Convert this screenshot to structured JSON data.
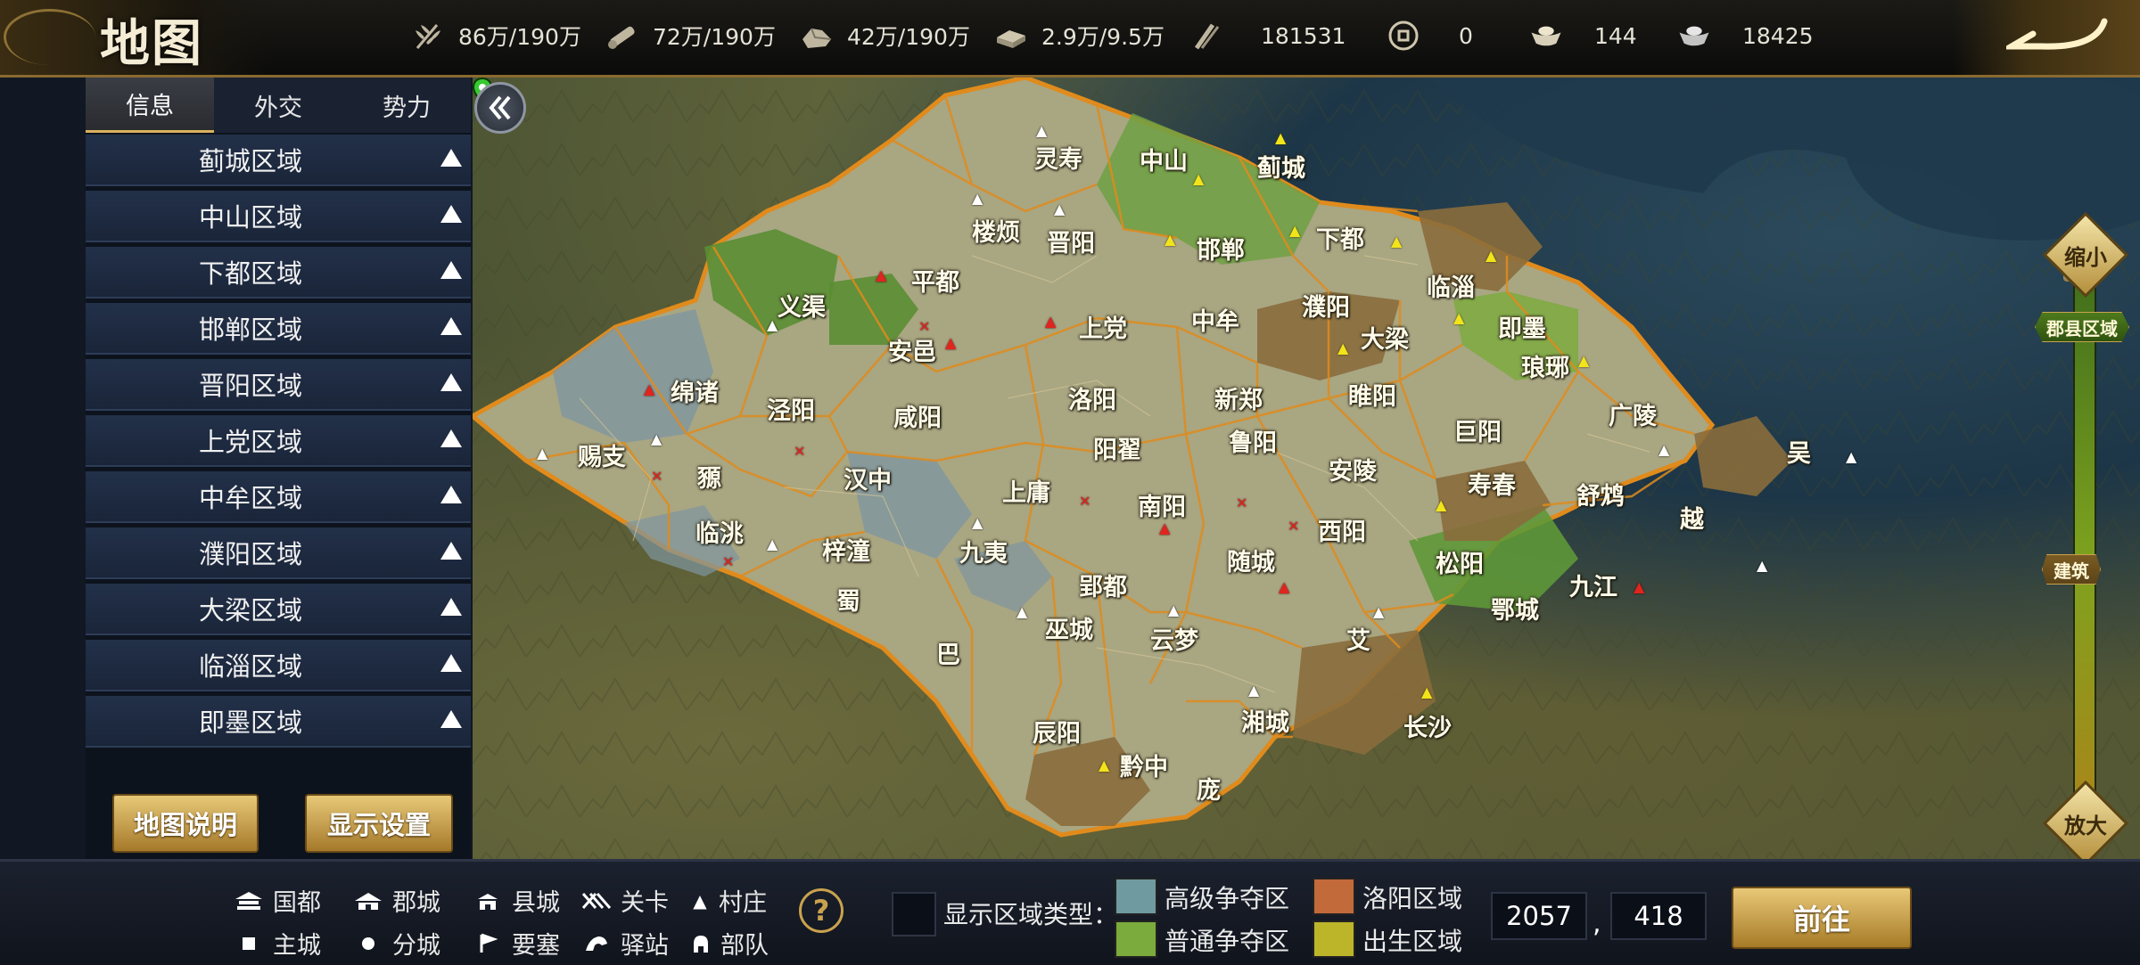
{
  "title": "地图",
  "resources": [
    {
      "icon": "wheat-icon",
      "value": "86万/190万"
    },
    {
      "icon": "wood-icon",
      "value": "72万/190万"
    },
    {
      "icon": "stone-icon",
      "value": "42万/190万"
    },
    {
      "icon": "iron-icon",
      "value": "2.9万/9.5万"
    },
    {
      "icon": "scroll-icon",
      "value": "181531"
    },
    {
      "icon": "coin-icon",
      "value": "0"
    },
    {
      "icon": "gold-ingot-icon",
      "value": "144"
    },
    {
      "icon": "silver-ingot-icon",
      "value": "18425"
    }
  ],
  "tabs": [
    {
      "label": "信息",
      "active": true
    },
    {
      "label": "外交",
      "active": false
    },
    {
      "label": "势力",
      "active": false
    }
  ],
  "region_list": [
    "蓟城区域",
    "中山区域",
    "下都区域",
    "邯郸区域",
    "晋阳区域",
    "上党区域",
    "中牟区域",
    "濮阳区域",
    "大梁区域",
    "临淄区域",
    "即墨区域"
  ],
  "buttons": {
    "map_info": "地图说明",
    "display_settings": "显示设置",
    "goto": "前往"
  },
  "zoom": {
    "zoom_out": "缩小",
    "zoom_in": "放大",
    "level_county": "郡县区域",
    "level_building": "建筑"
  },
  "map_regions": [
    "灵寿",
    "中山",
    "蓟城",
    "楼烦",
    "晋阳",
    "邯郸",
    "下都",
    "临淄",
    "平都",
    "义渠",
    "上党",
    "濮阳",
    "中牟",
    "大梁",
    "即墨",
    "安邑",
    "琅琊",
    "绵诸",
    "泾阳",
    "咸阳",
    "洛阳",
    "新郑",
    "睢阳",
    "巨阳",
    "广陵",
    "吴",
    "豲",
    "阳翟",
    "鲁阳",
    "安陵",
    "赐支",
    "汉中",
    "上庸",
    "南阳",
    "寿春",
    "舒鸩",
    "临洮",
    "西阳",
    "越",
    "九夷",
    "梓潼",
    "随城",
    "松阳",
    "九江",
    "蜀",
    "郢都",
    "巫城",
    "云梦",
    "鄂城",
    "艾",
    "巴",
    "辰阳",
    "湘城",
    "长沙",
    "黔中",
    "庞"
  ],
  "legend": {
    "row1": [
      {
        "icon": "capital-icon",
        "label": "国都"
      },
      {
        "icon": "prefecture-icon",
        "label": "郡城"
      },
      {
        "icon": "county-icon",
        "label": "县城"
      },
      {
        "icon": "pass-icon",
        "label": "关卡"
      },
      {
        "icon": "village-icon",
        "label": "村庄"
      }
    ],
    "row2": [
      {
        "icon": "main-city-icon",
        "label": "主城"
      },
      {
        "icon": "branch-city-icon",
        "label": "分城"
      },
      {
        "icon": "fortress-icon",
        "label": "要塞"
      },
      {
        "icon": "post-station-icon",
        "label": "驿站"
      },
      {
        "icon": "troop-icon",
        "label": "部队"
      }
    ]
  },
  "zone_types": {
    "label": "显示区域类型：",
    "items": [
      {
        "label": "高级争夺区",
        "color": "#6f9aa0"
      },
      {
        "label": "洛阳区域",
        "color": "#c26a3a"
      },
      {
        "label": "普通争夺区",
        "color": "#7bab3c"
      },
      {
        "label": "出生区域",
        "color": "#bcb52a"
      }
    ]
  },
  "coords": {
    "x": "2057",
    "sep": ",",
    "y": "418"
  },
  "colors": {
    "gold": "#d9b15e",
    "neutral_region": "#a9a682",
    "contested_high": "#7f96a0",
    "contested_normal": "#6fa043",
    "birth_region": "#8a6d3c",
    "border": "#e08b1c"
  }
}
